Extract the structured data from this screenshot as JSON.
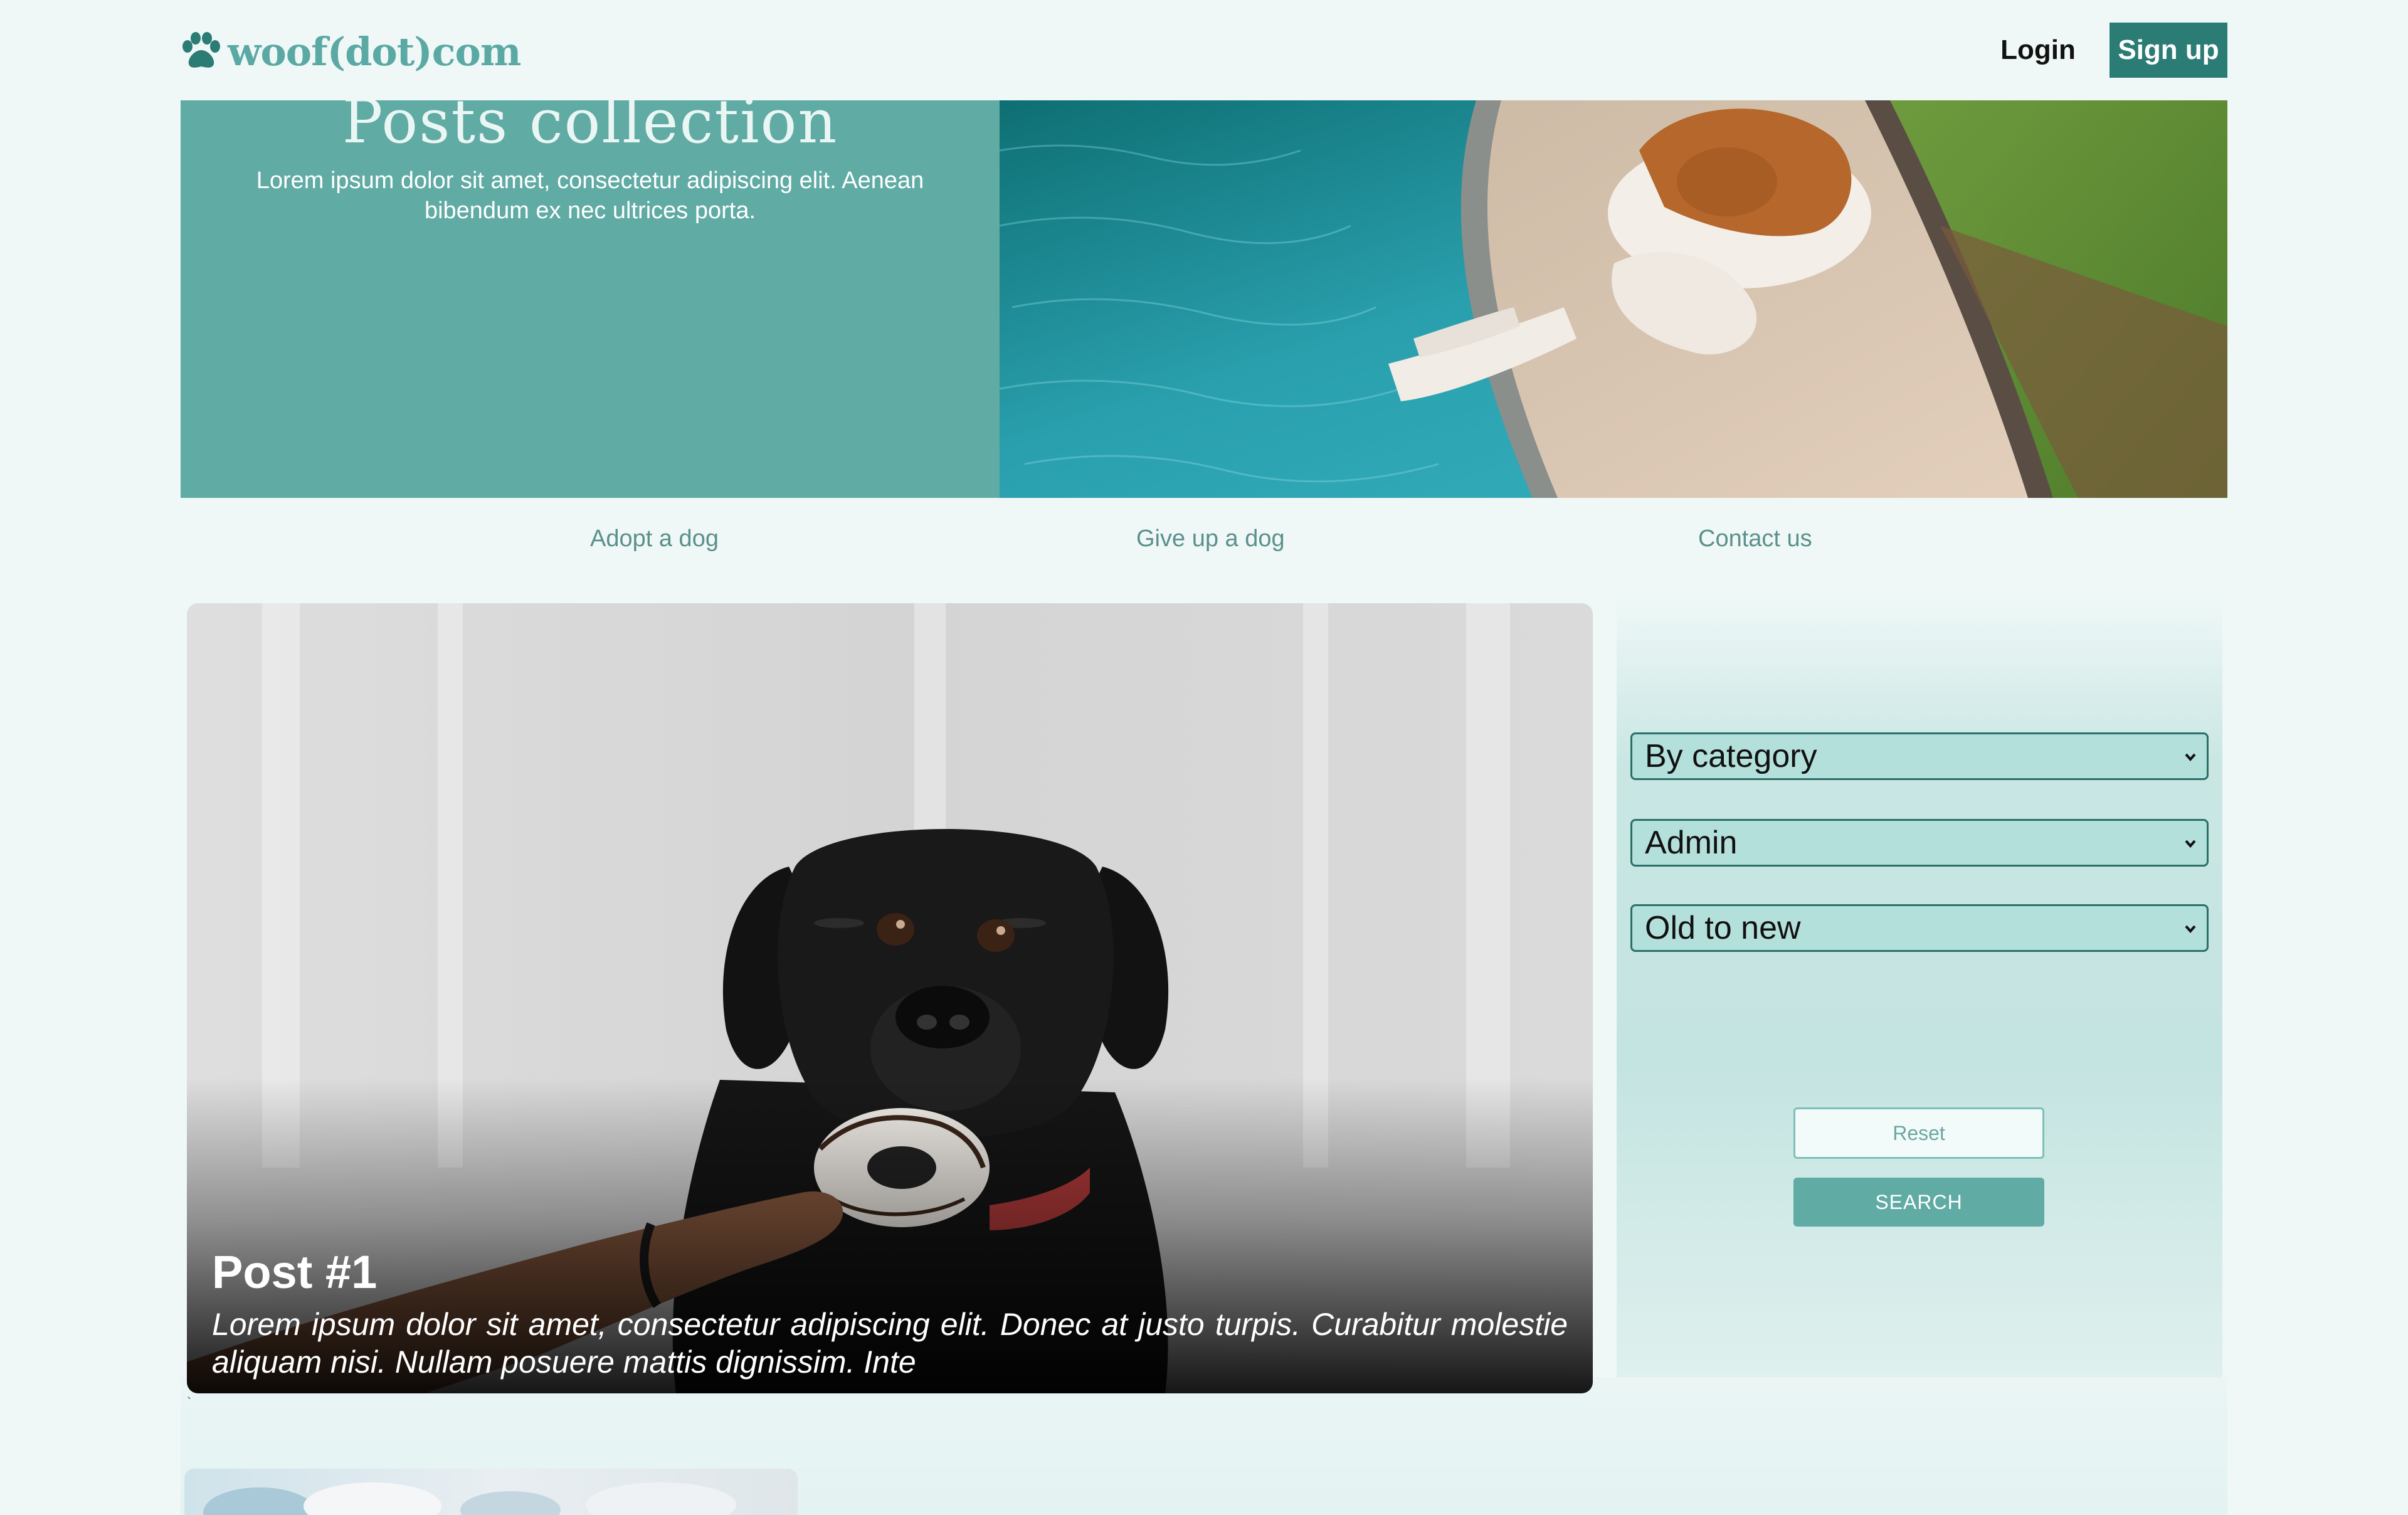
{
  "header": {
    "logo_text": "woof(dot)com",
    "login_label": "Login",
    "signup_label": "Sign up"
  },
  "hero": {
    "title": "Posts collection",
    "description": "Lorem ipsum dolor sit amet, consectetur adipiscing elit. Aenean bibendum ex nec ultrices porta."
  },
  "nav": {
    "items": [
      {
        "label": "Adopt a dog"
      },
      {
        "label": "Give up a dog"
      },
      {
        "label": "Contact us"
      }
    ]
  },
  "posts": [
    {
      "title": "Post #1",
      "excerpt": "Lorem ipsum dolor sit amet, consectetur adipiscing elit. Donec at justo turpis. Curabitur molestie aliquam nisi. Nullam posuere mattis dignissim. Inte"
    }
  ],
  "filters": {
    "category": "By category",
    "author": "Admin",
    "sort": "Old to new",
    "reset_label": "Reset",
    "search_label": "SEARCH"
  },
  "colors": {
    "brand_teal": "#60aba4",
    "brand_dark": "#2b7c74",
    "background": "#eff8f7"
  }
}
